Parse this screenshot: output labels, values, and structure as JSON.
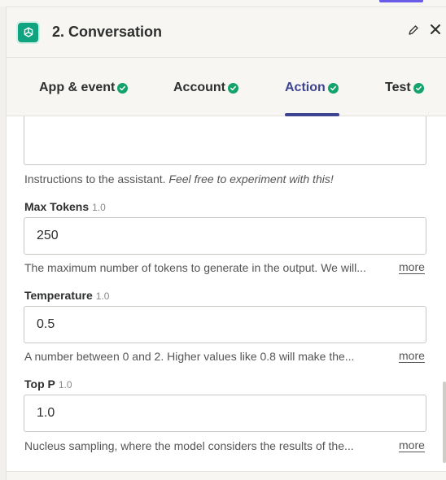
{
  "header": {
    "title": "2. Conversation",
    "app_icon": "openai-logo-icon",
    "edit_icon": "pencil-icon",
    "close_icon": "close-icon"
  },
  "tabs": [
    {
      "label": "App & event",
      "complete": true
    },
    {
      "label": "Account",
      "complete": true
    },
    {
      "label": "Action",
      "complete": true,
      "active": true
    },
    {
      "label": "Test",
      "complete": true
    }
  ],
  "instructions": {
    "help_plain": "Instructions to the assistant. ",
    "help_italic": "Feel free to experiment with this!"
  },
  "fields": [
    {
      "label": "Max Tokens",
      "version": "1.0",
      "value": "250",
      "help": "The maximum number of tokens to generate in the output. We will...",
      "more": "more"
    },
    {
      "label": "Temperature",
      "version": "1.0",
      "value": "0.5",
      "help": "A number between 0 and 2. Higher values like 0.8 will make the...",
      "more": "more"
    },
    {
      "label": "Top P",
      "version": "1.0",
      "value": "1.0",
      "help": "Nucleus sampling, where the model considers the results of the...",
      "more": "more"
    }
  ],
  "colors": {
    "accent": "#3d4592",
    "check": "#13a36b",
    "brand": "#10a37f",
    "top_accent": "#695be8"
  }
}
